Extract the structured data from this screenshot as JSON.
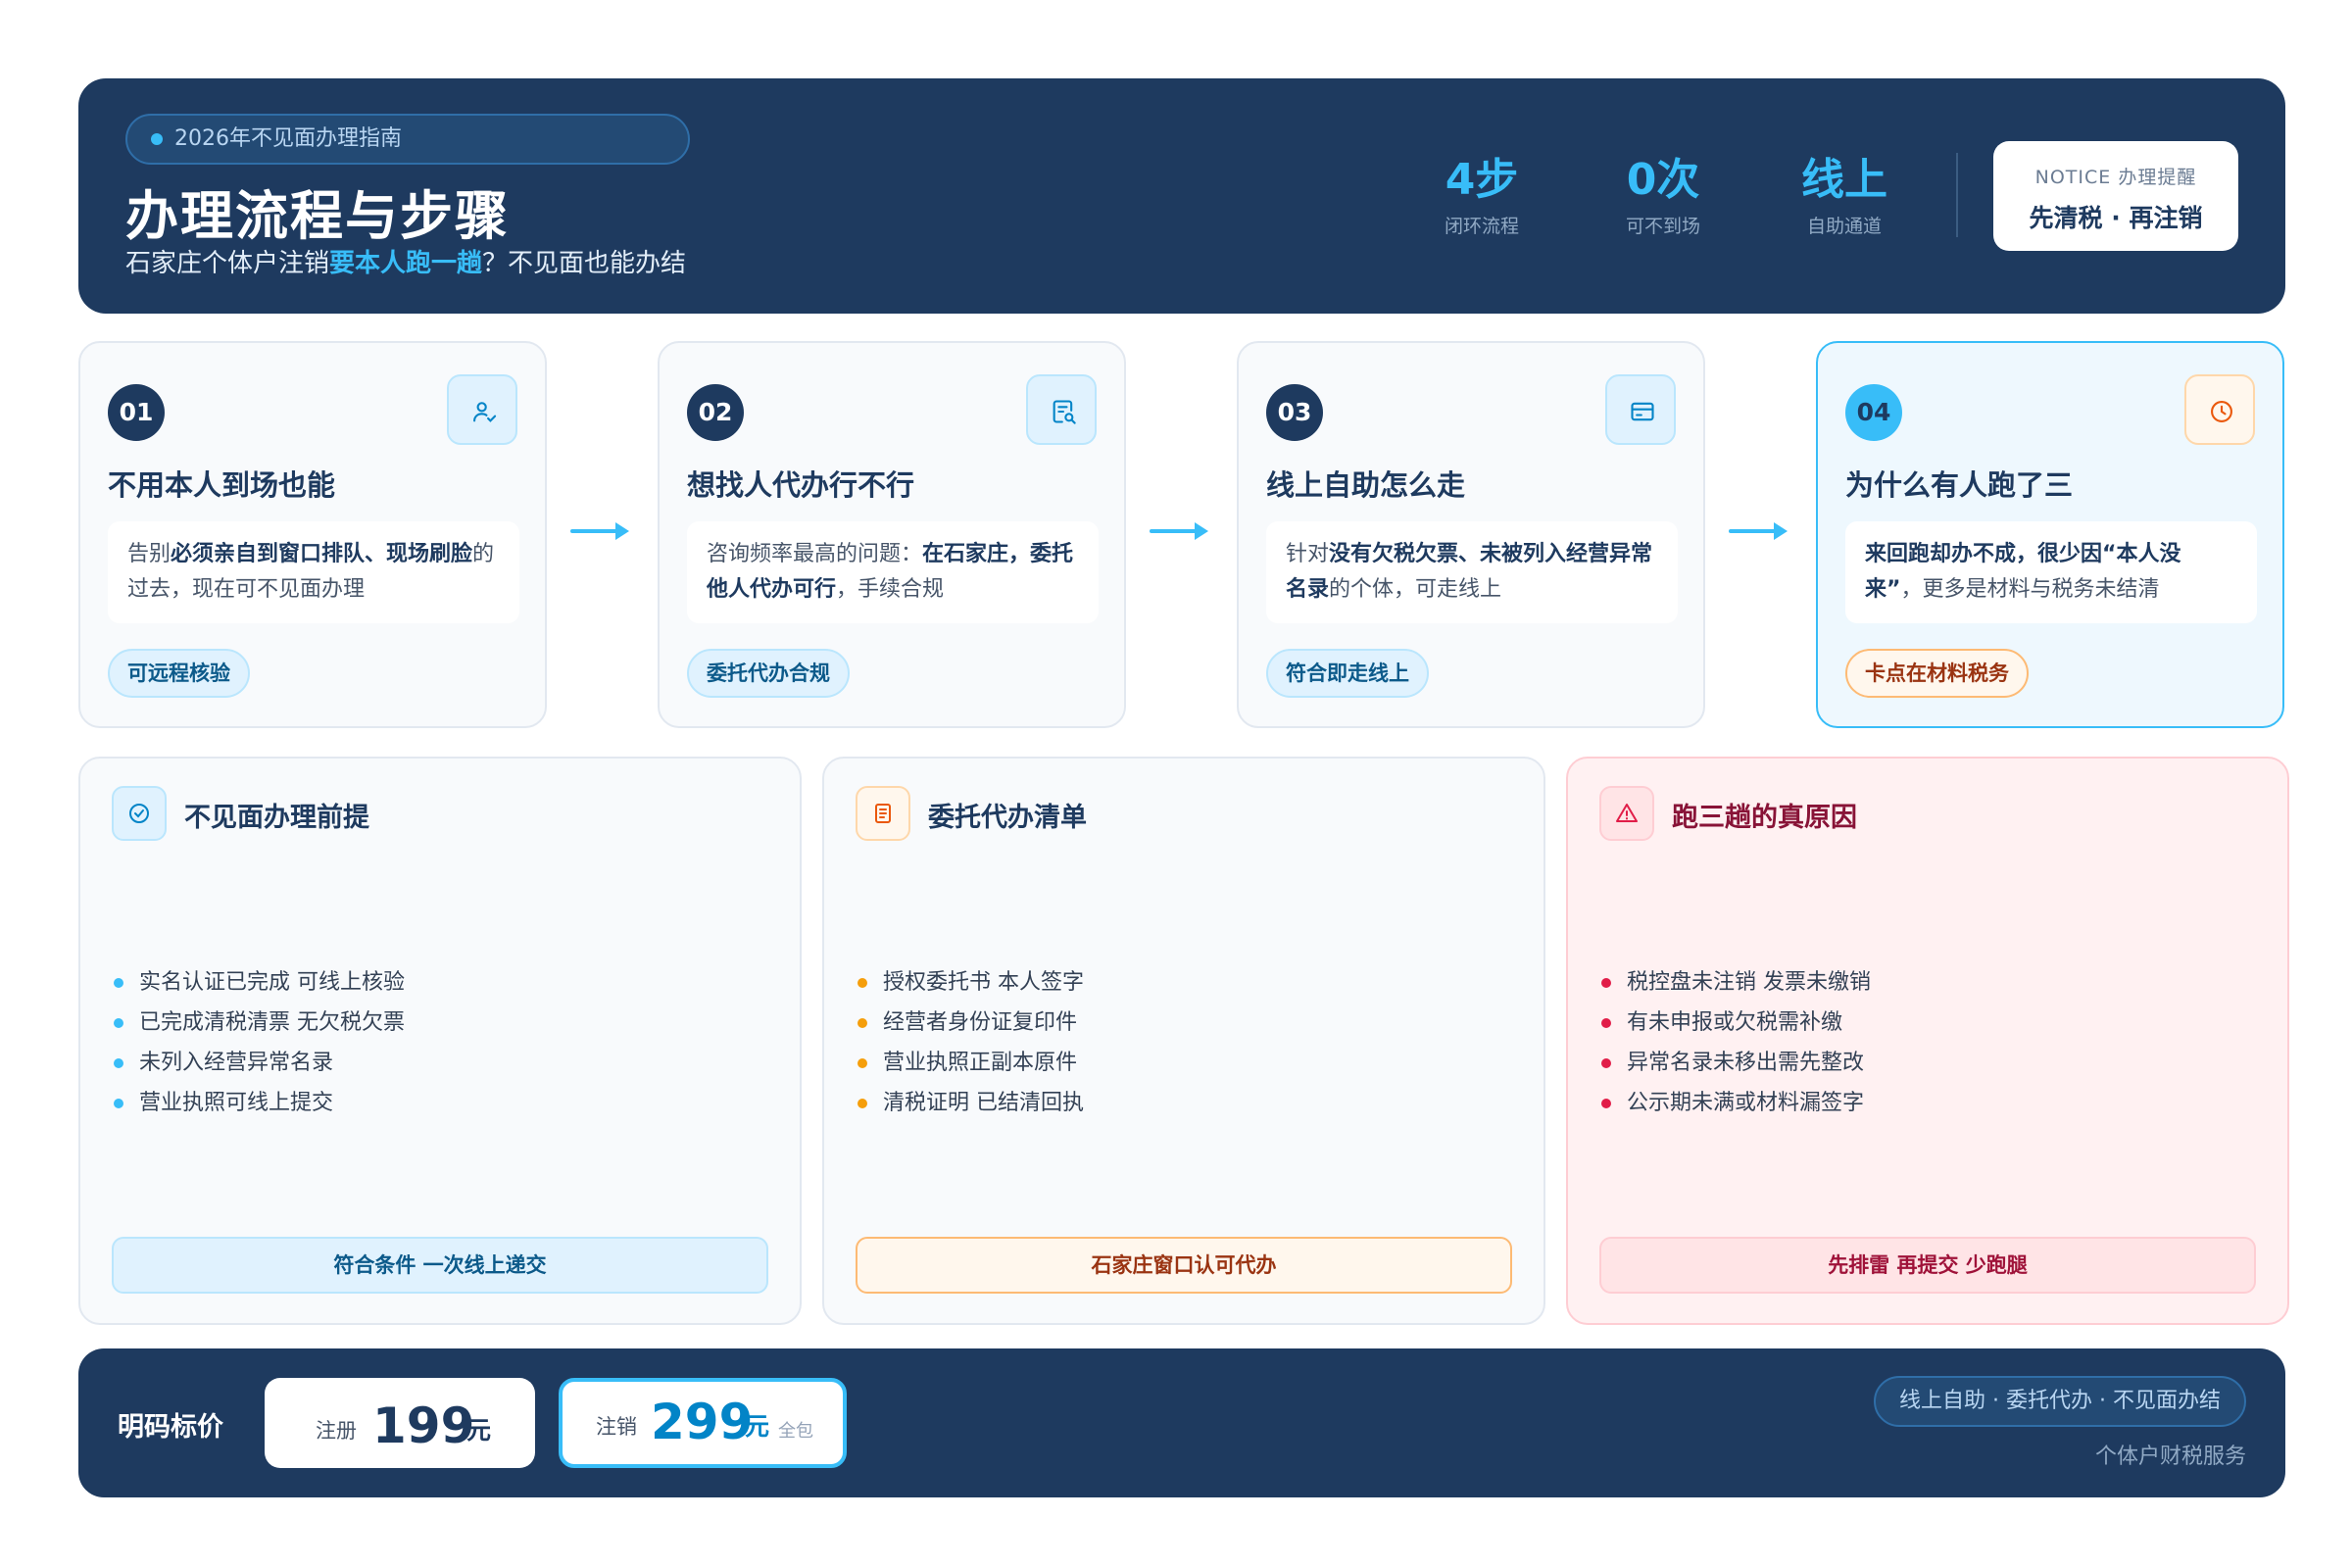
{
  "header": {
    "tag": "2026年不见面办理指南",
    "title": "办理流程与步骤",
    "subtitle_pre": "石家庄个体户注销",
    "subtitle_highlight": "要本人跑一趟",
    "subtitle_post": "？不见面也能办结",
    "stats": [
      {
        "value": "4步",
        "label": "闭环流程"
      },
      {
        "value": "0次",
        "label": "可不到场"
      },
      {
        "value": "线上",
        "label": "自助通道"
      }
    ],
    "notice": {
      "kicker": "NOTICE 办理提醒",
      "text": "先清税 · 再注销"
    }
  },
  "steps": [
    {
      "num": "01",
      "title": "不用本人到场也能",
      "desc_a": "告别",
      "desc_b": "必须亲自到窗口排队、现场刷脸",
      "desc_c": "的过去，现在可不见面办理",
      "chip": "可远程核验",
      "icon": "user-check-icon"
    },
    {
      "num": "02",
      "title": "想找人代办行不行",
      "desc_a": "咨询频率最高的问题：",
      "desc_b": "在石家庄，委托他人代办可行",
      "desc_c": "，手续合规",
      "chip": "委托代办合规",
      "icon": "document-search-icon"
    },
    {
      "num": "03",
      "title": "线上自助怎么走",
      "desc_a": "针对",
      "desc_b": "没有欠税欠票、未被列入经营异常名录",
      "desc_c": "的个体，可走线上",
      "chip": "符合即走线上",
      "icon": "card-icon"
    },
    {
      "num": "04",
      "title": "为什么有人跑了三",
      "desc_a": "",
      "desc_b": "来回跑却办不成，很少因“本人没来”",
      "desc_c": "，更多是材料与税务未结清",
      "chip": "卡点在材料税务",
      "icon": "clock-icon"
    }
  ],
  "panels": [
    {
      "title": "不见面办理前提",
      "icon": "check-circle-icon",
      "items": [
        "实名认证已完成 可线上核验",
        "已完成清税清票 无欠税欠票",
        "未列入经营异常名录",
        "营业执照可线上提交"
      ],
      "button": "符合条件 一次线上递交"
    },
    {
      "title": "委托代办清单",
      "icon": "document-icon",
      "items": [
        "授权委托书 本人签字",
        "经营者身份证复印件",
        "营业执照正副本原件",
        "清税证明 已结清回执"
      ],
      "button": "石家庄窗口认可代办"
    },
    {
      "title": "跑三趟的真原因",
      "icon": "warning-icon",
      "items": [
        "税控盘未注销 发票未缴销",
        "有未申报或欠税需补缴",
        "异常名录未移出需先整改",
        "公示期未满或材料漏签字"
      ],
      "button": "先排雷 再提交 少跑腿"
    }
  ],
  "footer": {
    "title": "明码标价",
    "prices": [
      {
        "name": "注册",
        "value": "199",
        "unit": "元",
        "extra": ""
      },
      {
        "name": "注销",
        "value": "299",
        "unit": "元",
        "extra": "全包"
      }
    ],
    "pill": "线上自助 · 委托代办 · 不见面办结",
    "sub": "个体户财税服务"
  },
  "colors": {
    "navy": "#1e3a5f",
    "accent": "#38bdf8",
    "orange": "#f59e0b",
    "red": "#e11d48"
  }
}
